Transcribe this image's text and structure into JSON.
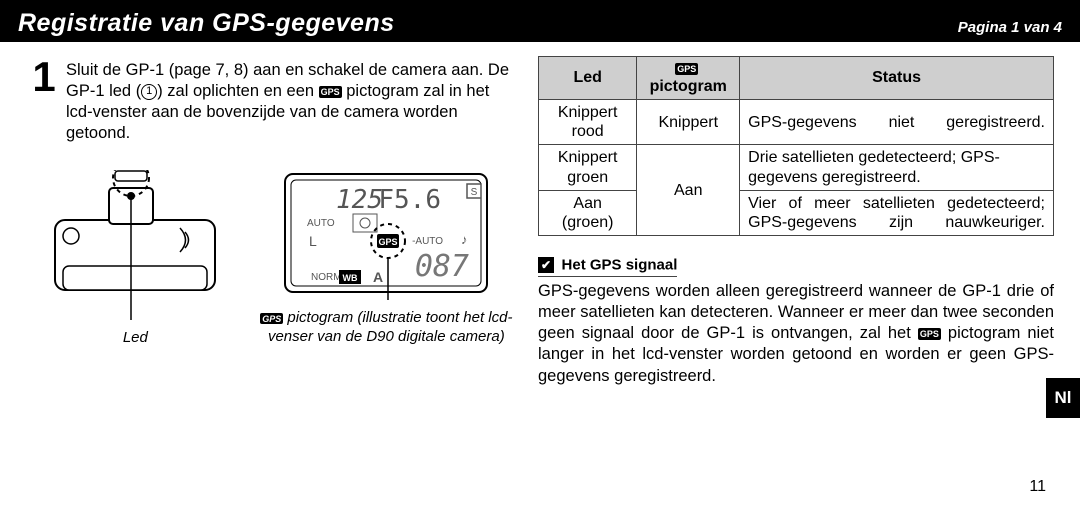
{
  "header": {
    "title": "Registratie van GPS-gegevens",
    "pager": "Pagina 1 van 4"
  },
  "step": {
    "num": "1",
    "text_a": "Sluit de GP-1 (page 7, 8) aan en schakel de camera aan. De GP-1 led (",
    "text_b": ") zal oplichten en een ",
    "text_c": " pictogram zal in het lcd-venster aan de bovenzijde van de camera worden getoond."
  },
  "fig": {
    "led_label": "Led",
    "lcd_label_a": " pictogram (illustratie toont het lcd-venser van de D90 digitale camera)"
  },
  "table": {
    "h1": "Led",
    "h2": "pictogram",
    "h3": "Status",
    "r1c1": "Knippert rood",
    "r1c2": "Knippert",
    "r1c3": "GPS-gegevens niet geregi­streerd.",
    "r2c1": "Knippert groen",
    "r23c2": "Aan",
    "r2c3": "Drie satellieten gedetecteerd; GPS-gegevens geregistreerd.",
    "r3c1": "Aan (groen)",
    "r3c3": "Vier of meer satellieten gede­tecteerd; GPS-gegevens zijn nauwkeuriger."
  },
  "note": {
    "head": "Het GPS signaal",
    "body_a": "GPS-gegevens worden alleen geregistreerd wanneer de GP-1 drie of meer satellieten kan detecteren. Wanneer er meer dan twee seconden geen signaal door de GP-1 is ont­vangen, zal het ",
    "body_b": " pictogram niet langer in het lcd-venster worden getoond en worden er geen GPS-gegevens gere­gistreerd."
  },
  "page_num": "11",
  "side_tab": "Nl",
  "gps_icon": "GPS",
  "circ_1": "1",
  "check": "✔"
}
